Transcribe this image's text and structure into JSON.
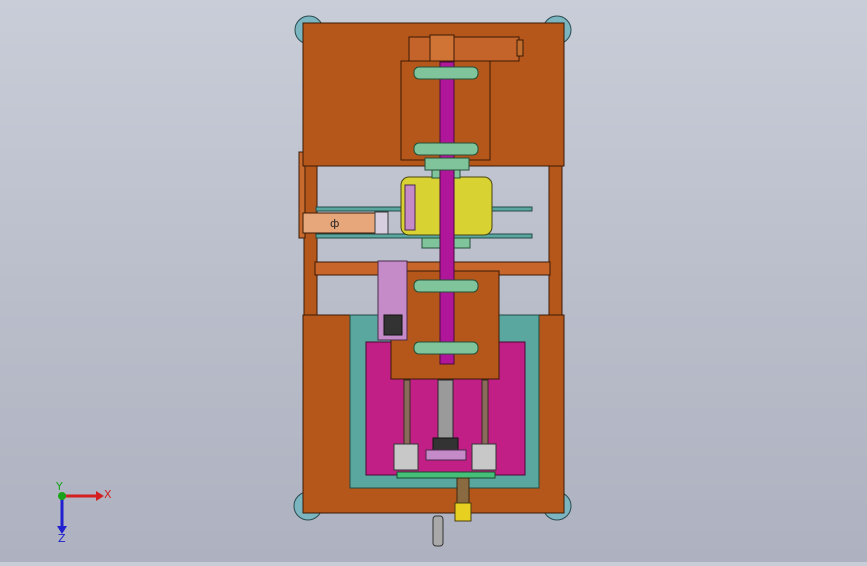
{
  "viewport": {
    "background": "#bfc3cf"
  },
  "triad": {
    "x_label": "X",
    "y_label": "Y",
    "z_label": "Z",
    "x_color": "#d42020",
    "y_color": "#1aa31a",
    "z_color": "#2020d0"
  },
  "model": {
    "frame_color": "#b5561a",
    "frame_edge": "#3a1a06",
    "shaft_color": "#b0169a",
    "bracket_color": "#7fc49a",
    "drum_color": "#d8d232",
    "carriage_color": "#c21f86",
    "rail_color": "#5aa7a0",
    "slider_color": "#c58ac8",
    "spring_color": "#e8d020",
    "foot_color": "#7bb6c0",
    "label_block_text": "ф"
  }
}
